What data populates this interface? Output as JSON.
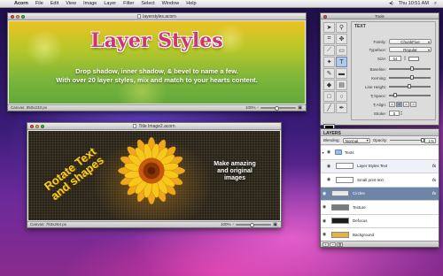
{
  "menubar": {
    "apple": "",
    "items": [
      "Acorn",
      "File",
      "Edit",
      "View",
      "Image",
      "Layer",
      "Filter",
      "Select",
      "Window",
      "Help"
    ],
    "clock": "Thu 10:51 AM",
    "icons": [
      "volume-icon",
      "spotlight-icon"
    ]
  },
  "window1": {
    "title": "layerstyles.acorn",
    "headline": "Layer Styles",
    "body_line1": "Drop shadow, inner shadow, & bevel to name a few.",
    "body_line2": "With over 20 layer styles, mix and match to your hearts content.",
    "canvas_info": "Canvas: 850x233 px",
    "zoom": "100%"
  },
  "window2": {
    "title": "Title Image2.acorn",
    "rotate_text_line1": "Rotate Text",
    "rotate_text_line2": "and shapes",
    "make_line1": "Make amazing",
    "make_line2": "and original",
    "make_line3": "images",
    "canvas_info": "Canvas: 763x264 px",
    "zoom": "100%"
  },
  "tools_palette": {
    "title": "Tools",
    "text_header": "TEXT",
    "family_label": "Family:",
    "family_value": "ChunkFive",
    "typeface_label": "Typeface:",
    "typeface_value": "Regular",
    "size_label": "Size:",
    "size_value": "64",
    "baseline_label": "Baseline:",
    "kerning_label": "Kerning:",
    "line_height_label": "Line Height:",
    "space_label": "¶ Space:",
    "align_label": "¶ Align:",
    "stroke_label": "Stroke:",
    "stroke_value": "0",
    "text_color": "#ffffff",
    "fg_color": "#000000",
    "bg_color": "#ffffff"
  },
  "layers_panel": {
    "header": "LAYERS",
    "blending_label": "Blending:",
    "blending_value": "Normal",
    "opacity_label": "Opacity:",
    "opacity_value": "1%",
    "layers": [
      {
        "name": "Texts",
        "kind": "group",
        "fx": false
      },
      {
        "name": "Layer Styles Text",
        "kind": "layer",
        "fx": true,
        "thumb": "#ffffff"
      },
      {
        "name": "Small print text",
        "kind": "layer",
        "fx": true,
        "thumb": "#ffffff"
      },
      {
        "name": "Circles",
        "kind": "layer",
        "fx": true,
        "thumb": "#e8e8e8",
        "selected": true
      },
      {
        "name": "Texture",
        "kind": "layer",
        "fx": false,
        "thumb": "#7a7a7a"
      },
      {
        "name": "Defocus",
        "kind": "layer",
        "fx": false,
        "thumb": "#1a1a1a"
      },
      {
        "name": "Background",
        "kind": "layer",
        "fx": false,
        "thumb": "#e7b13a"
      }
    ]
  }
}
